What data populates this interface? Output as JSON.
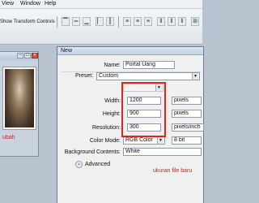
{
  "menu": [
    "View",
    "Window",
    "Help"
  ],
  "toolbar": {
    "show_transform_controls": "Show Transform Controls",
    "icons": [
      "align-top-icon",
      "align-vcenter-icon",
      "align-bottom-icon",
      "align-left-icon",
      "align-hcenter-icon",
      "align-right-icon",
      "distribute-top-icon",
      "distribute-vcenter-icon",
      "distribute-bottom-icon",
      "distribute-left-icon"
    ]
  },
  "document": {
    "note": "ubah"
  },
  "dialog": {
    "title": "New",
    "name_label": "Name:",
    "name_value": "Portal Uang",
    "preset_label": "Preset:",
    "preset_value": "Custom",
    "size_value": "",
    "width_label": "Width:",
    "width_value": "1200",
    "width_unit": "pixels",
    "height_label": "Height:",
    "height_value": "900",
    "height_unit": "pixels",
    "resolution_label": "Resolution:",
    "resolution_value": "300",
    "resolution_unit": "pixels/inch",
    "color_mode_label": "Color Mode:",
    "color_mode_value": "RGB Color",
    "bit_depth_value": "8 bit",
    "background_label": "Background Contents:",
    "background_value": "White",
    "advanced_label": "Advanced",
    "note": "ukuran file baru"
  }
}
